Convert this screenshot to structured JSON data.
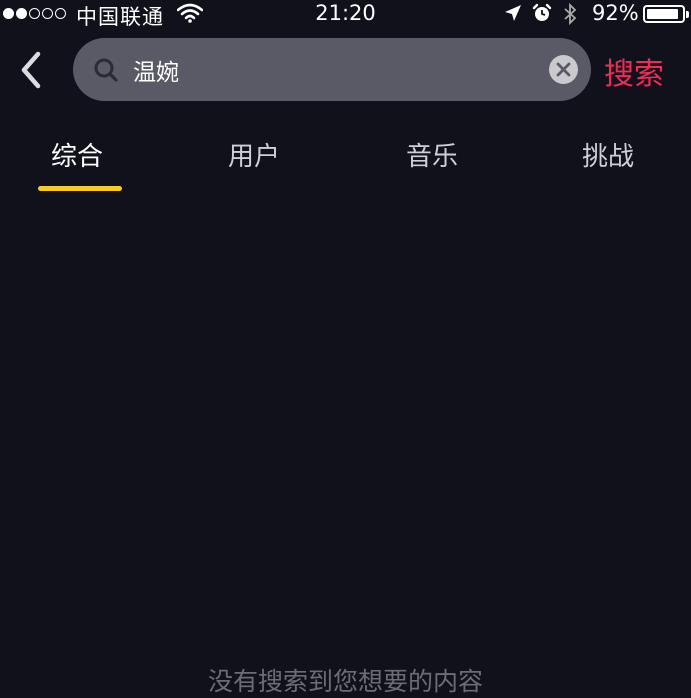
{
  "status_bar": {
    "carrier": "中国联通",
    "time": "21:20",
    "battery": "92%",
    "battery_level": 0.92,
    "signal_bars_filled": 2,
    "signal_bars_total": 5
  },
  "search": {
    "query": "温婉",
    "submit_label": "搜索"
  },
  "tabs": [
    {
      "label": "综合",
      "active": true
    },
    {
      "label": "用户",
      "active": false
    },
    {
      "label": "音乐",
      "active": false
    },
    {
      "label": "挑战",
      "active": false
    }
  ],
  "empty_state": {
    "message": "没有搜索到您想要的内容"
  },
  "colors": {
    "background": "#11111c",
    "accent_submit": "#ee2c55",
    "tab_indicator": "#f9c924"
  },
  "icons": [
    "back-icon",
    "search-icon",
    "clear-icon",
    "wifi-icon",
    "location-icon",
    "alarm-icon",
    "bluetooth-icon",
    "battery-icon"
  ]
}
